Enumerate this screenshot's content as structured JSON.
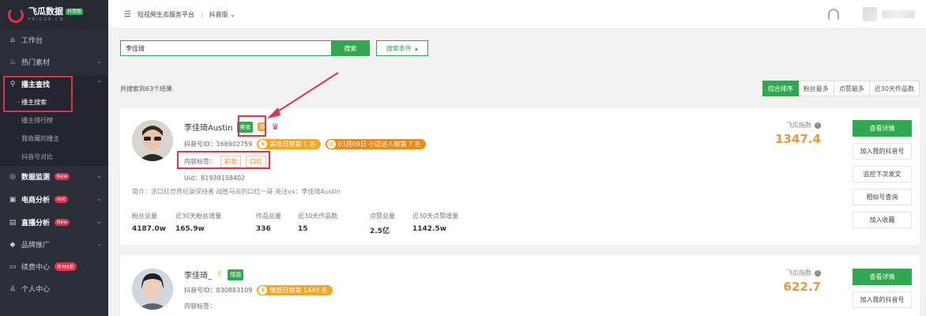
{
  "sidebar": {
    "logo": {
      "name": "飞瓜数据",
      "badge": "抖音版",
      "sub": "FEIGUA.CN"
    },
    "items": [
      {
        "label": "工作台",
        "icon": "home-icon"
      },
      {
        "label": "热门素材",
        "icon": "fire-icon"
      },
      {
        "label": "播主查找",
        "icon": "search-icon"
      },
      {
        "label": "数据监测",
        "icon": "monitor-icon",
        "badge": "New"
      },
      {
        "label": "电商分析",
        "icon": "cart-icon",
        "badge": "Hot"
      },
      {
        "label": "直播分析",
        "icon": "live-icon",
        "badge": "New"
      },
      {
        "label": "品牌推广",
        "icon": "diamond-icon"
      },
      {
        "label": "续费中心",
        "icon": "card-icon",
        "badge": "年付6折"
      },
      {
        "label": "个人中心",
        "icon": "user-icon"
      }
    ],
    "sub_items": [
      "· 播主搜索",
      "· 播主排行榜",
      "· 我收藏的播主",
      "· 抖音号对比"
    ]
  },
  "topbar": {
    "platform": "短视频生态服务平台",
    "separator": "|",
    "version": "抖音版"
  },
  "search": {
    "value": "李佳琦",
    "button": "搜索",
    "conditions": "搜索条件"
  },
  "results": {
    "count_text": "共搜索到63个结果",
    "sort_tabs": [
      "综合排序",
      "粉丝最多",
      "点赞最多",
      "近30天作品数"
    ]
  },
  "cards": [
    {
      "name": "李佳琦Austin",
      "tag": "美妆",
      "douyin_id": "抖音号ID：166902759",
      "rank1": "美妆日榜第 1 名",
      "rank2": "03月09日 小店达人榜第 7 名",
      "content_label": "内容标签：",
      "content_tags": [
        "彩妆",
        "口红"
      ],
      "uid": "Uid：81939158402",
      "intro": "简介：涂口红世界纪录保持者 战胜马云的口红一哥 关注vx：李佳琦Austin",
      "stats": [
        {
          "label": "粉丝总量",
          "value": "4187.0w"
        },
        {
          "label": "近30天粉丝增量",
          "value": "165.9w"
        },
        {
          "label": "作品总量",
          "value": "336"
        },
        {
          "label": "近30天作品数",
          "value": "15"
        },
        {
          "label": "点赞总量",
          "value": "2.5亿"
        },
        {
          "label": "近30天点赞增量",
          "value": "1142.5w"
        }
      ],
      "index_label": "飞瓜指数",
      "index_value": "1347.4",
      "actions": [
        "查看详情",
        "加入我的抖音号",
        "监控下次发文",
        "相似号查询",
        "加入收藏"
      ]
    },
    {
      "name": "李佳琦_",
      "tag": "情感",
      "douyin_id": "抖音号ID：830883109",
      "rank1": "情感日榜第 1449 名",
      "content_label": "内容标签：",
      "index_label": "飞瓜指数",
      "index_value": "622.7",
      "actions": [
        "查看详情",
        "加入我的抖音号"
      ]
    }
  ],
  "colors": {
    "accent": "#2fa84f",
    "highlight": "#e0324b",
    "orange": "#f0953a",
    "sidebar": "#2b2f3a"
  }
}
